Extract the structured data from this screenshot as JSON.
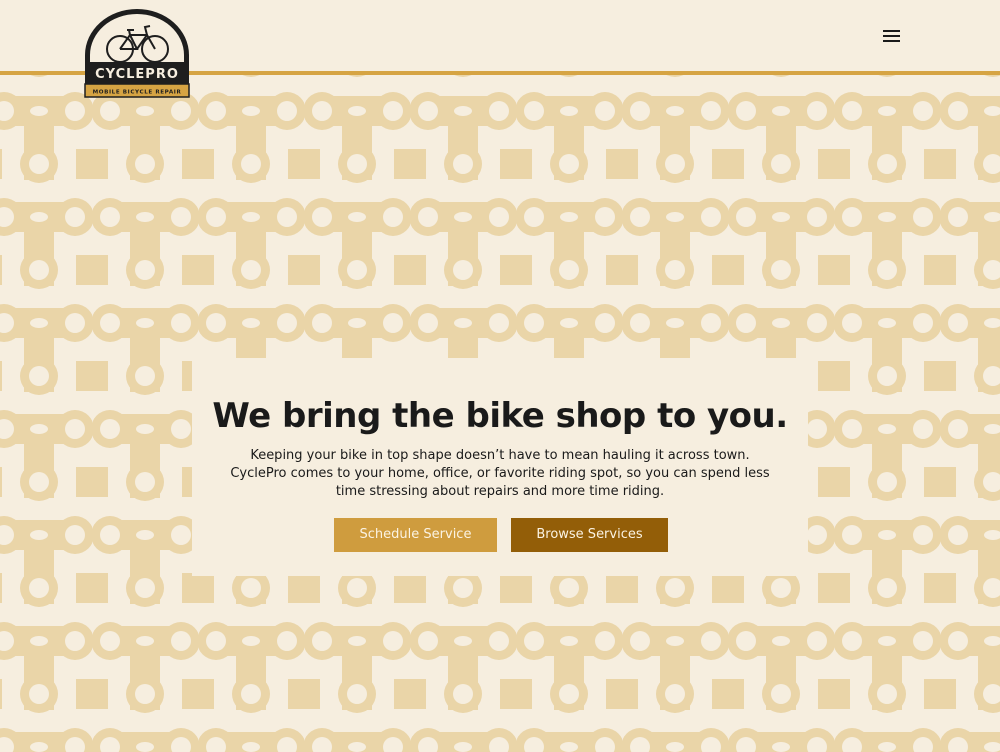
{
  "brand": {
    "name": "CYCLEPRO",
    "tagline": "MOBILE BICYCLE REPAIR"
  },
  "nav": {
    "menu_icon": "hamburger-menu-icon"
  },
  "hero": {
    "title": "We bring the bike shop to you.",
    "text": "Keeping your bike in top shape doesn’t have to mean hauling it across town. CyclePro comes to your home, office, or favorite riding spot, so you can spend less time stressing about repairs and more time riding.",
    "primary_button": "Schedule Service",
    "secondary_button": "Browse Services"
  },
  "colors": {
    "background": "#f6eedf",
    "pattern": "#ead5a8",
    "accent_gold": "#d6a443",
    "button_primary": "#cf9c3e",
    "button_secondary": "#935e08",
    "logo_dark": "#1e1e1e"
  }
}
